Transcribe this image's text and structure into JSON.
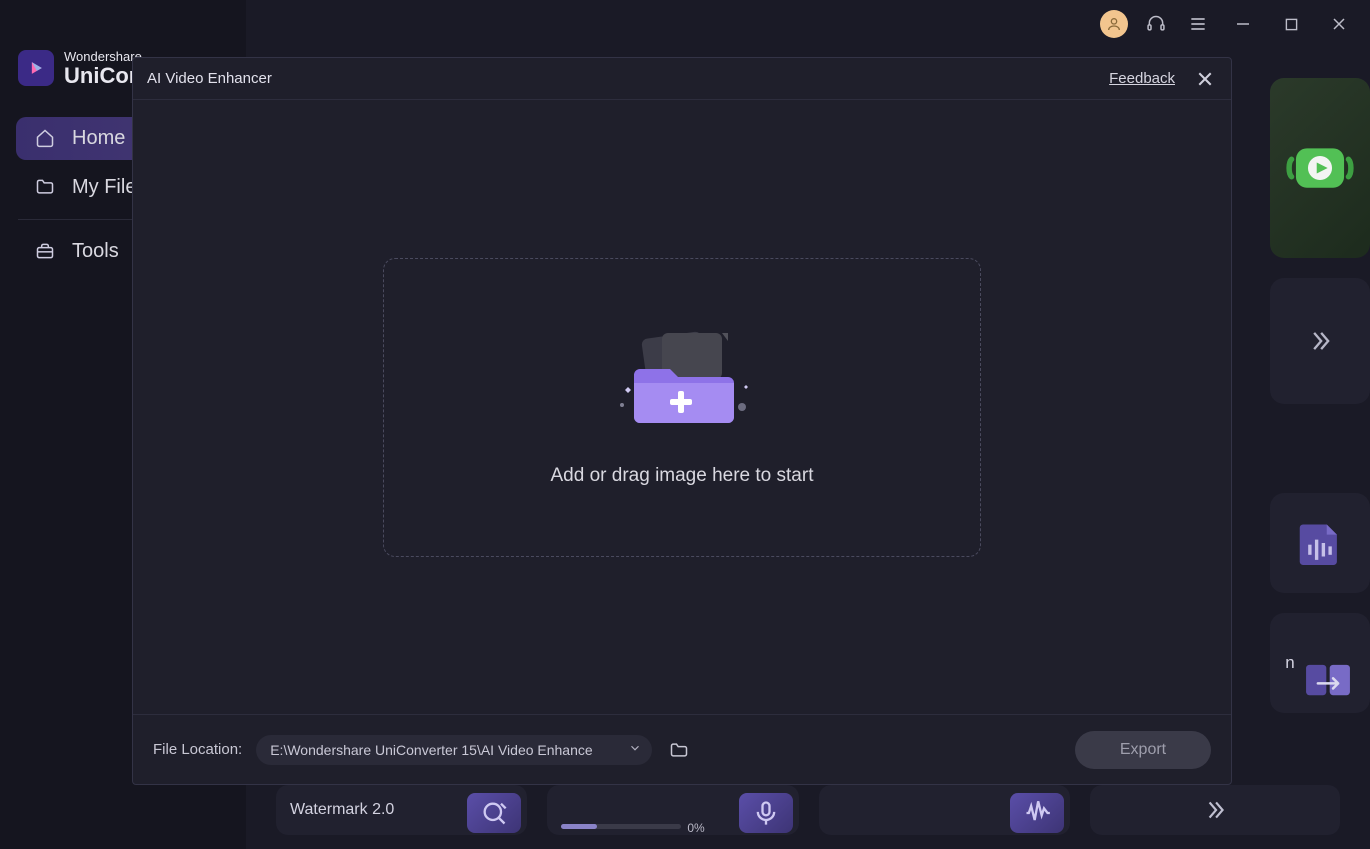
{
  "app": {
    "brand_top": "Wondershare",
    "brand_main": "UniConverter"
  },
  "sidebar": {
    "items": [
      {
        "label": "Home",
        "icon": "home"
      },
      {
        "label": "My Files",
        "icon": "folder"
      },
      {
        "label": "Tools",
        "icon": "toolbox"
      }
    ]
  },
  "modal": {
    "title": "AI Video Enhancer",
    "feedback_label": "Feedback",
    "dropzone_text": "Add or drag image here to start",
    "file_location_label": "File Location:",
    "file_location_value": "E:\\Wondershare UniConverter 15\\AI Video Enhance",
    "export_label": "Export"
  },
  "bottom_tools": {
    "watermark": "Watermark 2.0",
    "vocal_progress_pct": "0%",
    "side_label_fragment": "n"
  }
}
